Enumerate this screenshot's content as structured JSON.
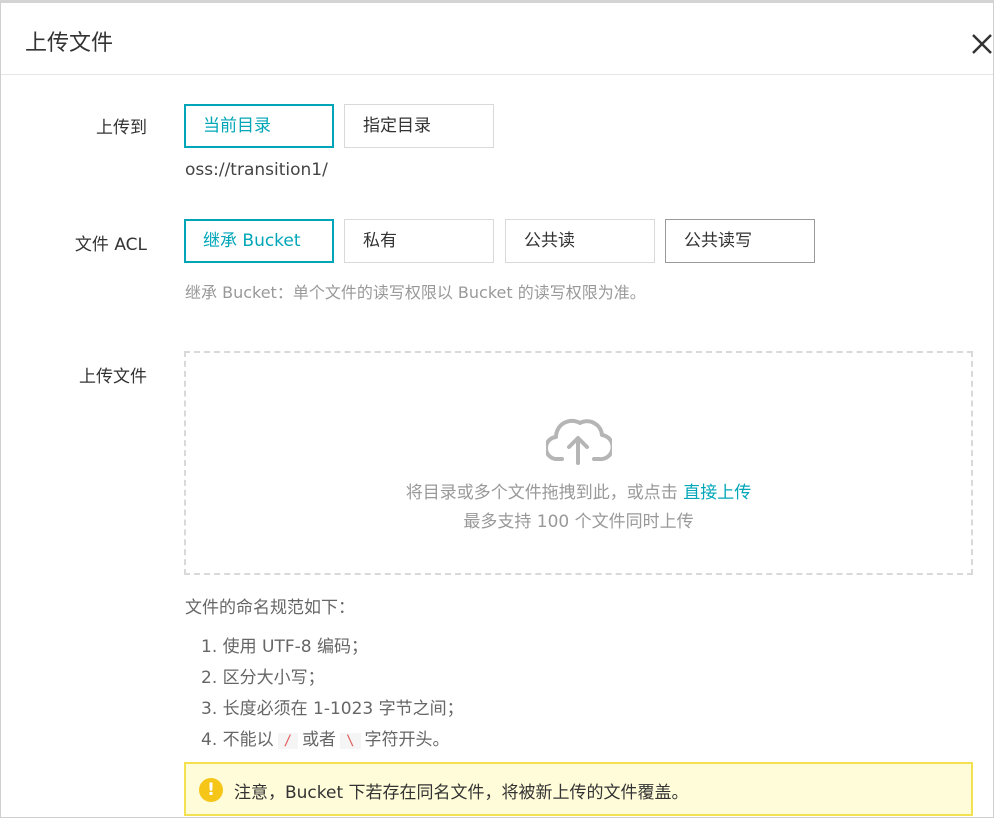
{
  "dialog": {
    "title": "上传文件"
  },
  "upload_to": {
    "label": "上传到",
    "options": [
      "当前目录",
      "指定目录"
    ],
    "path": "oss://transition1/"
  },
  "acl": {
    "label": "文件 ACL",
    "options": [
      "继承 Bucket",
      "私有",
      "公共读",
      "公共读写"
    ],
    "hint": "继承 Bucket：单个文件的读写权限以 Bucket 的读写权限为准。"
  },
  "upload_file": {
    "label": "上传文件",
    "drop_text": "将目录或多个文件拖拽到此，或点击",
    "drop_link": "直接上传",
    "drop_limit": "最多支持 100 个文件同时上传"
  },
  "naming": {
    "title": "文件的命名规范如下：",
    "rule1": "1. 使用 UTF-8 编码；",
    "rule2": "2. 区分大小写；",
    "rule3": "3. 长度必须在 1-1023 字节之间；",
    "rule4_prefix": "4. 不能以",
    "rule4_code1": "/",
    "rule4_mid": "或者",
    "rule4_code2": "\\",
    "rule4_suffix": "字符开头。"
  },
  "alert": {
    "icon": "warning-icon",
    "text": "注意，Bucket 下若存在同名文件，将被新上传的文件覆盖。"
  },
  "colors": {
    "accent": "#00a6b8",
    "warning_bg": "#fffcd9",
    "warning_border": "#f3e151",
    "warning_icon": "#f5c518"
  }
}
